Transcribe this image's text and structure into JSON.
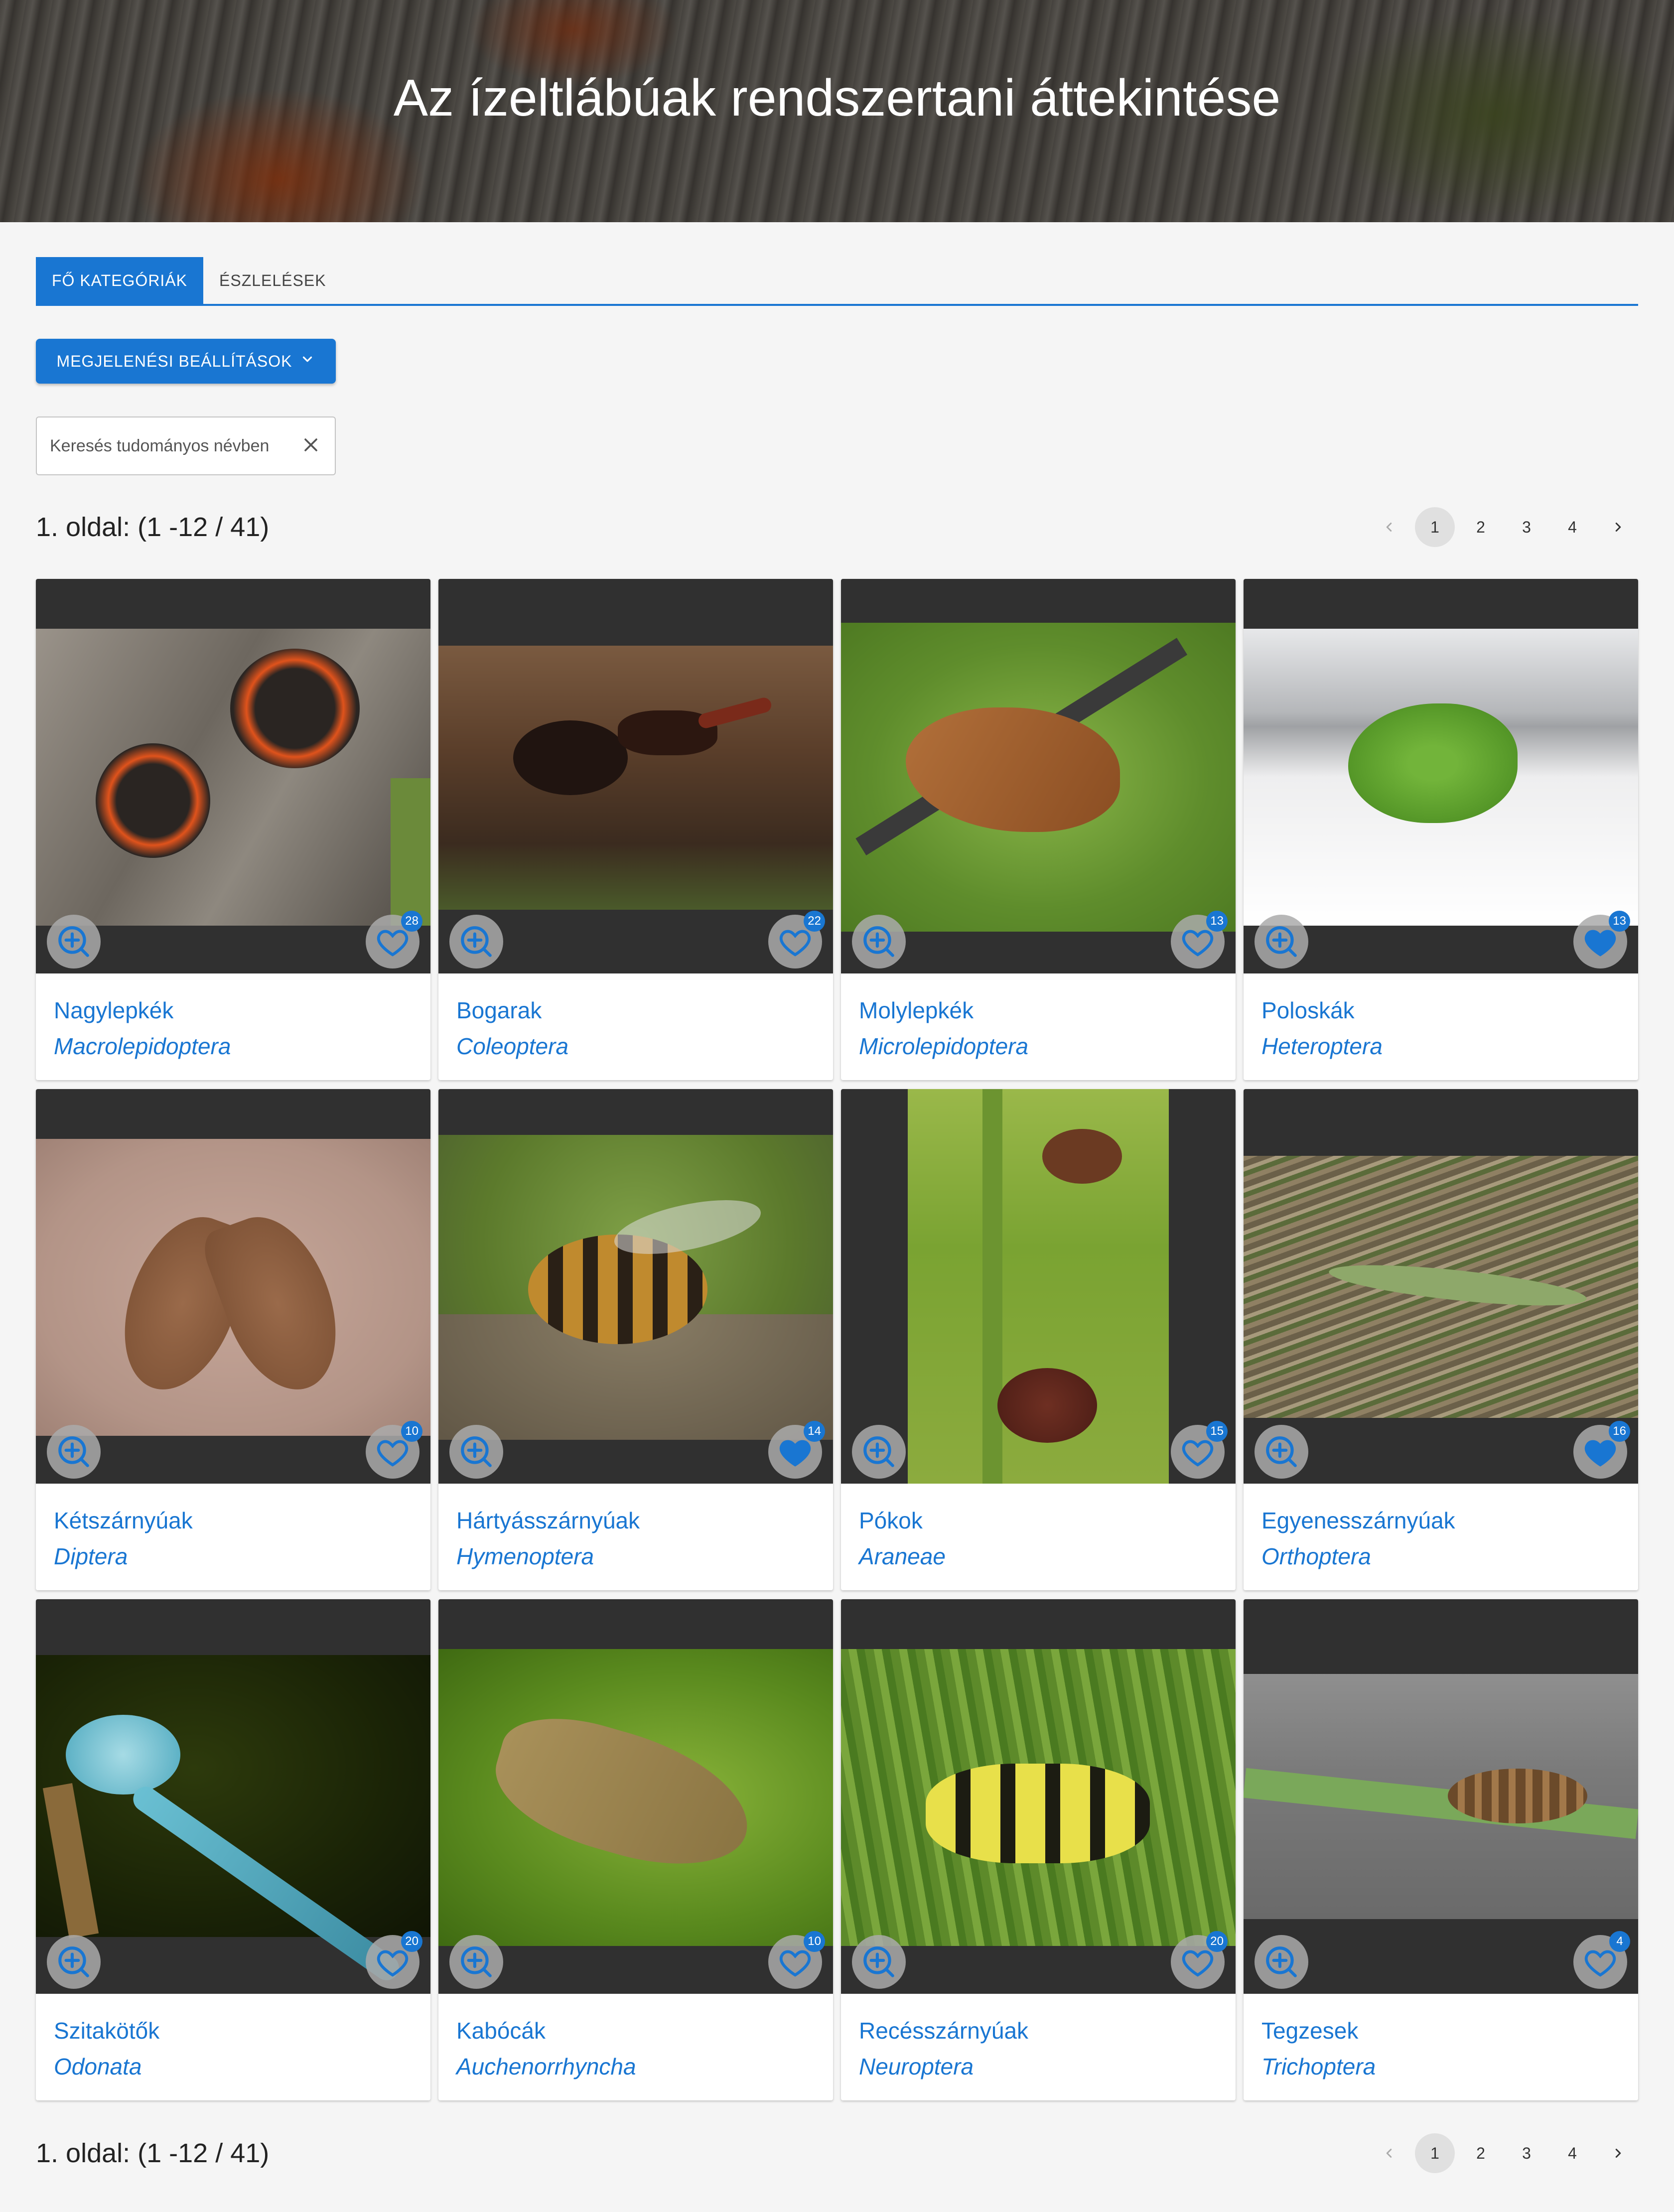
{
  "header": {
    "title": "Az ízeltlábúak rendszertani áttekintése"
  },
  "tabs": [
    {
      "label": "FŐ KATEGÓRIÁK",
      "active": true
    },
    {
      "label": "ÉSZLELÉSEK",
      "active": false
    }
  ],
  "settings": {
    "label": "MEGJELENÉSI BEÁLLÍTÁSOK"
  },
  "search": {
    "placeholder": "Keresés tudományos névben"
  },
  "pagination": {
    "info": "1. oldal: (1 -12 / 41)",
    "pages": [
      "1",
      "2",
      "3",
      "4"
    ],
    "current": "1"
  },
  "colors": {
    "accent": "#1976d2",
    "media_bg": "#303030"
  },
  "categories": [
    {
      "name": "Nagylepkék",
      "scientific": "Macrolepidoptera",
      "count": "28",
      "favorited": false
    },
    {
      "name": "Bogarak",
      "scientific": "Coleoptera",
      "count": "22",
      "favorited": false
    },
    {
      "name": "Molylepkék",
      "scientific": "Microlepidoptera",
      "count": "13",
      "favorited": false
    },
    {
      "name": "Poloskák",
      "scientific": "Heteroptera",
      "count": "13",
      "favorited": true
    },
    {
      "name": "Kétszárnyúak",
      "scientific": "Diptera",
      "count": "10",
      "favorited": false
    },
    {
      "name": "Hártyásszárnyúak",
      "scientific": "Hymenoptera",
      "count": "14",
      "favorited": true
    },
    {
      "name": "Pókok",
      "scientific": "Araneae",
      "count": "15",
      "favorited": false
    },
    {
      "name": "Egyenesszárnyúak",
      "scientific": "Orthoptera",
      "count": "16",
      "favorited": true
    },
    {
      "name": "Szitakötők",
      "scientific": "Odonata",
      "count": "20",
      "favorited": false
    },
    {
      "name": "Kabócák",
      "scientific": "Auchenorrhyncha",
      "count": "10",
      "favorited": false
    },
    {
      "name": "Recésszárnyúak",
      "scientific": "Neuroptera",
      "count": "20",
      "favorited": false
    },
    {
      "name": "Tegzesek",
      "scientific": "Trichoptera",
      "count": "4",
      "favorited": false
    }
  ]
}
